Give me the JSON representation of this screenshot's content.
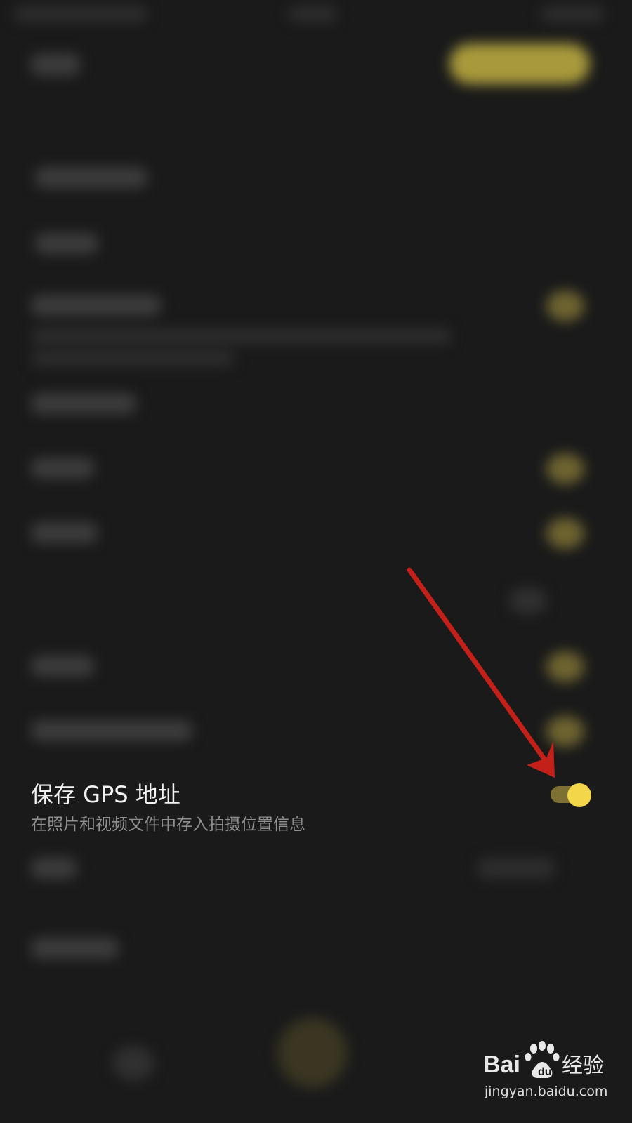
{
  "setting": {
    "title": "保存 GPS 地址",
    "description": "在照片和视频文件中存入拍摄位置信息",
    "toggle_on": true
  },
  "watermark": {
    "logo_text": "Baidu 经验",
    "url": "jingyan.baidu.com"
  },
  "colors": {
    "background": "#1a1a1a",
    "accent": "#f4d64a",
    "arrow": "#c4201a"
  }
}
